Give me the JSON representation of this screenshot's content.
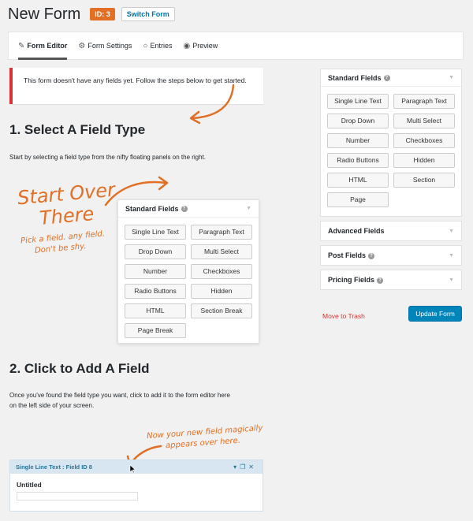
{
  "header": {
    "title": "New Form",
    "id_badge": "ID: 3",
    "switch_label": "Switch Form"
  },
  "tabs": [
    {
      "label": "Form Editor",
      "icon": "pencil-icon",
      "active": true
    },
    {
      "label": "Form Settings",
      "icon": "gears-icon",
      "active": false
    },
    {
      "label": "Entries",
      "icon": "comment-icon",
      "active": false
    },
    {
      "label": "Preview",
      "icon": "eye-icon",
      "active": false
    }
  ],
  "notice": {
    "text": "This form doesn't have any fields yet. Follow the steps below to get started."
  },
  "step1": {
    "heading": "1. Select A Field Type",
    "text": "Start by selecting a field type from the nifty floating panels on the right."
  },
  "demo_panel": {
    "title": "Standard Fields",
    "buttons": [
      "Single Line Text",
      "Paragraph Text",
      "Drop Down",
      "Multi Select",
      "Number",
      "Checkboxes",
      "Radio Buttons",
      "Hidden",
      "HTML",
      "Section Break",
      "Page Break"
    ]
  },
  "annotations": {
    "start_over_1": "Start Over",
    "start_over_2": "There",
    "pick_1": "Pick a field. any field.",
    "pick_2": "Don't be shy.",
    "new_field_1": "Now your new field magically",
    "new_field_2": "appears over here."
  },
  "step2": {
    "heading": "2. Click to Add A Field",
    "text_1": "Once you've found the field type you want, click to add it to the form editor here",
    "text_2": "on the left side of your screen."
  },
  "sample_field": {
    "bar_label": "Single Line Text : Field ID 8",
    "label": "Untitled"
  },
  "sidebar": {
    "standard": {
      "title": "Standard Fields",
      "buttons": [
        "Single Line Text",
        "Paragraph Text",
        "Drop Down",
        "Multi Select",
        "Number",
        "Checkboxes",
        "Radio Buttons",
        "Hidden",
        "HTML",
        "Section",
        "Page"
      ]
    },
    "advanced": "Advanced Fields",
    "post": "Post Fields",
    "pricing": "Pricing Fields",
    "trash": "Move to Trash",
    "update": "Update Form"
  },
  "colors": {
    "accent": "#e16f24",
    "primary": "#0085ba",
    "danger": "#dc3232"
  }
}
